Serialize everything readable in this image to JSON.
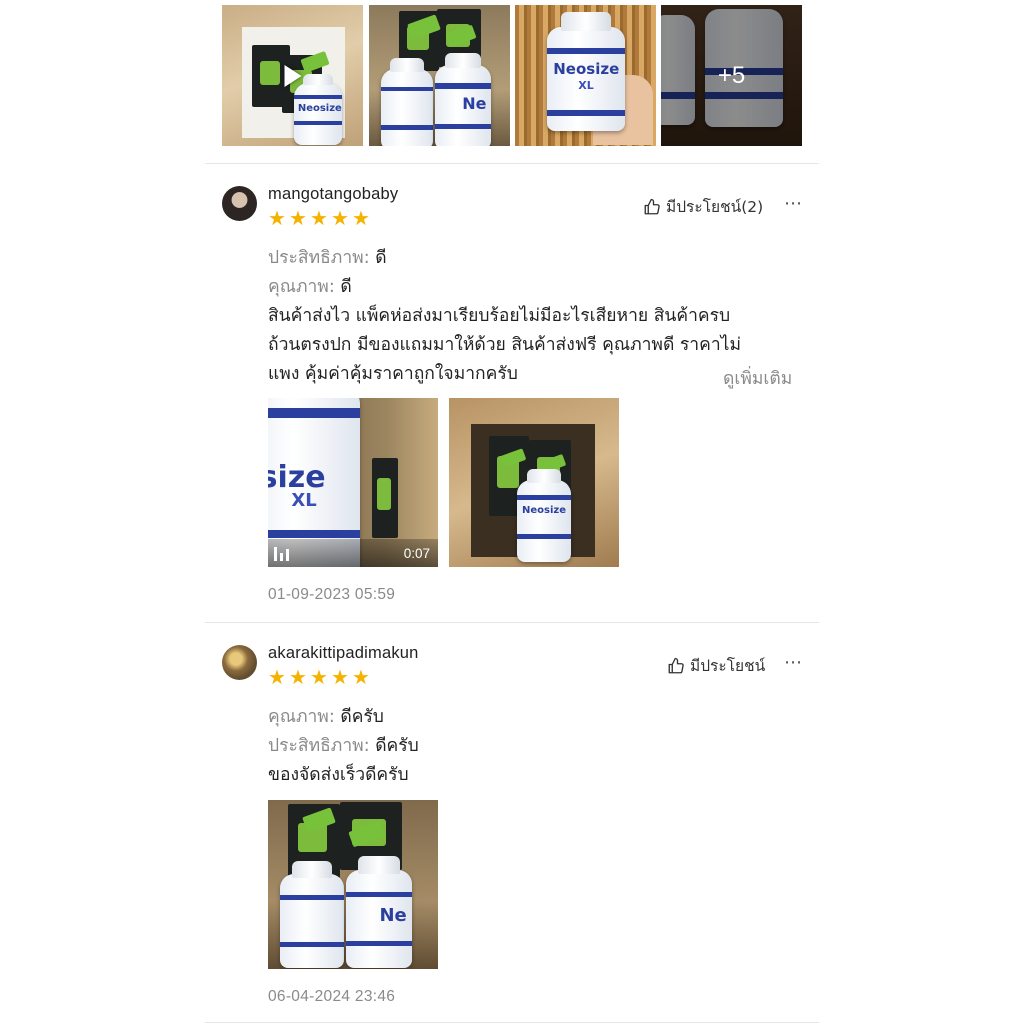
{
  "gallery": {
    "more_count": "+5"
  },
  "reviews": [
    {
      "username": "mangotangobaby",
      "rating": 5,
      "helpful_label": "มีประโยชน์(2)",
      "attributes": [
        {
          "key": "ประสิทธิภาพ:",
          "value": "ดี"
        },
        {
          "key": "คุณภาพ:",
          "value": "ดี"
        }
      ],
      "comment_lines": [
        "สินค้าส่งไว แพ็คห่อส่งมาเรียบร้อยไม่มีอะไรเสียหาย สินค้าครบ",
        "ถ้วนตรงปก มีของแถมมาให้ด้วย สินค้าส่งฟรี คุณภาพดี ราคาไม่",
        "แพง คุ้มค่าคุ้มราคาถูกใจมากครับ"
      ],
      "see_more": "ดูเพิ่มเติม",
      "video_duration": "0:07",
      "date": "01-09-2023 05:59"
    },
    {
      "username": "akarakittipadimakun",
      "rating": 5,
      "helpful_label": "มีประโยชน์",
      "attributes": [
        {
          "key": "คุณภาพ:",
          "value": "ดีครับ"
        },
        {
          "key": "ประสิทธิภาพ:",
          "value": "ดีครับ"
        }
      ],
      "comment_lines": [
        "ของจัดส่งเร็วดีครับ"
      ],
      "date": "06-04-2024 23:46"
    }
  ],
  "product": {
    "brand": "Neosize",
    "variant": "XL"
  },
  "colors": {
    "star": "#f5b200",
    "muted_text": "#8a8a8a",
    "divider": "#e6e6e6",
    "brand_blue": "#2b3f9e"
  },
  "icons": [
    "play-icon",
    "thumbs-up-icon",
    "more-dots-icon",
    "star-icon",
    "video-bars-icon"
  ]
}
